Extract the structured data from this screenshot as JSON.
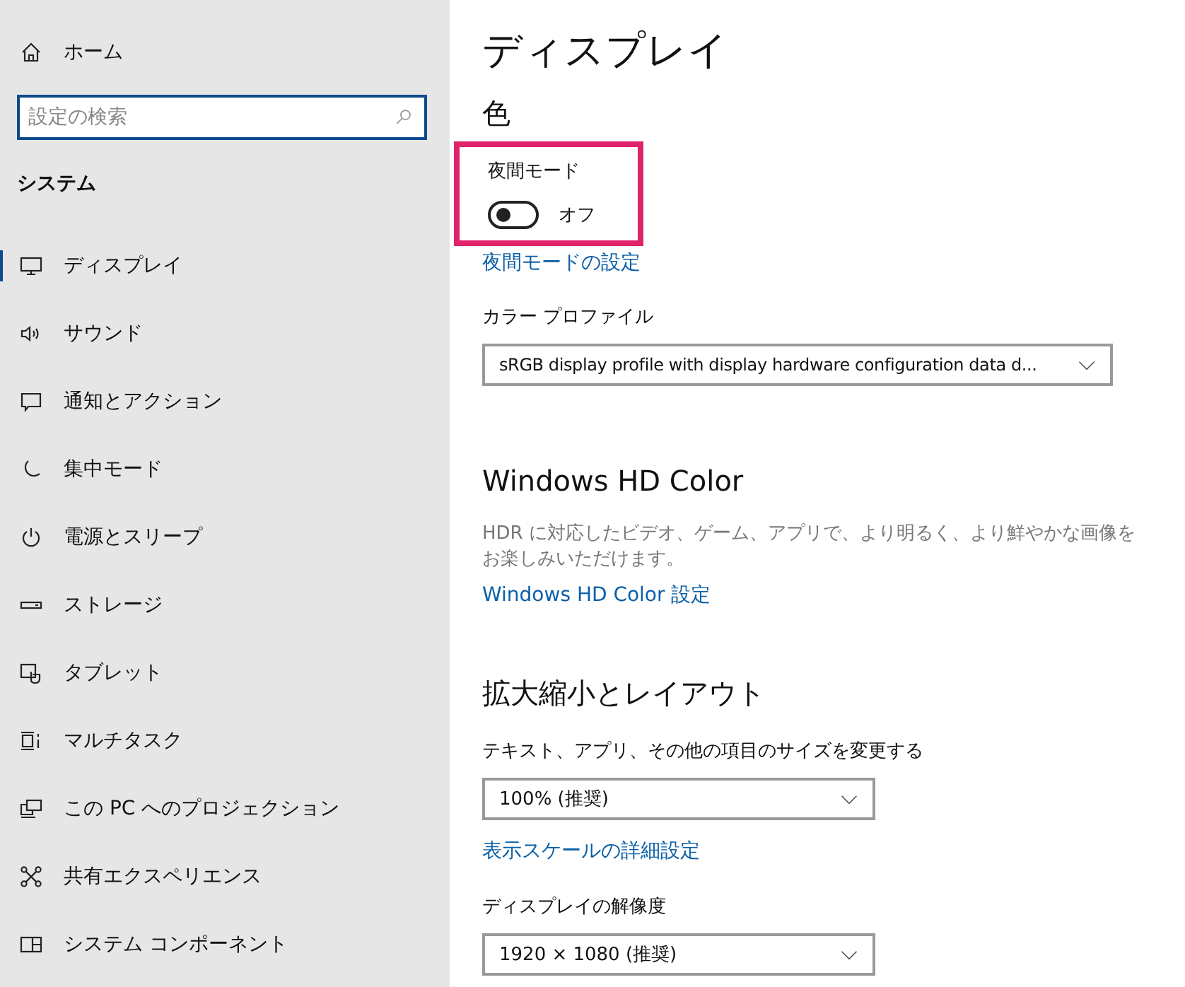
{
  "sidebar": {
    "home": "ホーム",
    "search": {
      "placeholder": "設定の検索"
    },
    "section": "システム",
    "items": [
      {
        "label": "ディスプレイ",
        "selected": true
      },
      {
        "label": "サウンド",
        "selected": false
      },
      {
        "label": "通知とアクション",
        "selected": false
      },
      {
        "label": "集中モード",
        "selected": false
      },
      {
        "label": "電源とスリープ",
        "selected": false
      },
      {
        "label": "ストレージ",
        "selected": false
      },
      {
        "label": "タブレット",
        "selected": false
      },
      {
        "label": "マルチタスク",
        "selected": false
      },
      {
        "label": "この PC へのプロジェクション",
        "selected": false
      },
      {
        "label": "共有エクスペリエンス",
        "selected": false
      },
      {
        "label": "システム コンポーネント",
        "selected": false
      }
    ]
  },
  "page": {
    "title": "ディスプレイ",
    "color_section": {
      "heading": "色",
      "night_mode": {
        "label": "夜間モード",
        "on": false,
        "state_text": "オフ",
        "highlighted": true
      },
      "link": "夜間モードの設定",
      "profile_label": "カラー プロファイル",
      "profile_value": "sRGB display profile with display hardware configuration data d..."
    },
    "hd_section": {
      "heading": "Windows HD Color",
      "description": "HDR に対応したビデオ、ゲーム、アプリで、より明るく、より鮮やかな画像をお楽しみいただけます。",
      "link": "Windows HD Color 設定"
    },
    "scale_section": {
      "heading": "拡大縮小とレイアウト",
      "size_label": "テキスト、アプリ、その他の項目のサイズを変更する",
      "size_value": "100% (推奨)",
      "link": "表示スケールの詳細設定",
      "resolution_label": "ディスプレイの解像度",
      "resolution_value": "1920 × 1080 (推奨)"
    }
  }
}
